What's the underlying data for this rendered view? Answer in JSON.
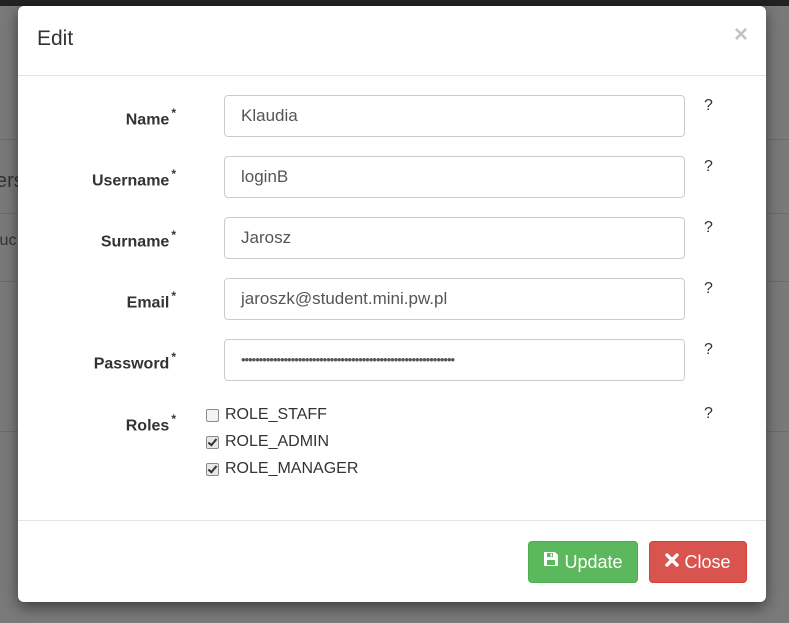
{
  "background": {
    "text_a": "ers",
    "text_b": "luc"
  },
  "modal": {
    "title": "Edit",
    "close_glyph": "×"
  },
  "form": {
    "fields": [
      {
        "label": "Name",
        "required": "*",
        "value": "Klaudia",
        "help": "?"
      },
      {
        "label": "Username",
        "required": "*",
        "value": "loginB",
        "help": "?"
      },
      {
        "label": "Surname",
        "required": "*",
        "value": "Jarosz",
        "help": "?"
      },
      {
        "label": "Email",
        "required": "*",
        "value": "jaroszk@student.mini.pw.pl",
        "help": "?"
      },
      {
        "label": "Password",
        "required": "*",
        "value": "••••••••••••••••••••••••••••••••••••••••••••••••••••••••••••",
        "help": "?"
      }
    ],
    "roles": {
      "label": "Roles",
      "required": "*",
      "help": "?",
      "options": [
        {
          "label": "ROLE_STAFF",
          "checked": false
        },
        {
          "label": "ROLE_ADMIN",
          "checked": true
        },
        {
          "label": "ROLE_MANAGER",
          "checked": true
        }
      ]
    }
  },
  "footer": {
    "update_label": "Update",
    "close_label": "Close",
    "update_icon": "save-icon",
    "close_icon": "times-icon"
  },
  "colors": {
    "success": "#5cb85c",
    "danger": "#d9534f",
    "backdrop": "#7a7a7a"
  }
}
